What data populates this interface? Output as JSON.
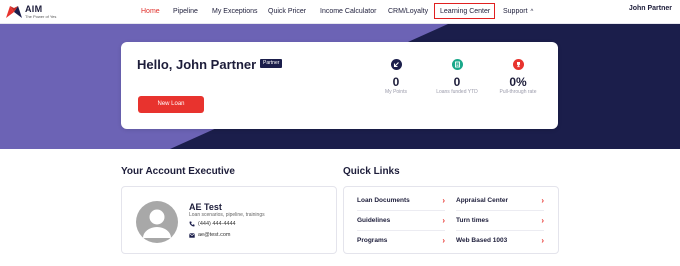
{
  "brand": {
    "name": "AIM",
    "tagline": "The Power of Yes",
    "accent": "#e8332e",
    "navy": "#1b1e4b",
    "purple": "#6c63b5"
  },
  "nav": {
    "items": [
      {
        "label": "Home",
        "active": true
      },
      {
        "label": "Pipeline"
      },
      {
        "label": "My Exceptions"
      },
      {
        "label": "Quick Pricer"
      },
      {
        "label": "Income Calculator"
      },
      {
        "label": "CRM/Loyalty"
      },
      {
        "label": "Learning Center",
        "highlighted": true
      },
      {
        "label": "Support"
      }
    ],
    "support_chevron_icon": "chevron-up-icon",
    "user": "John Partner"
  },
  "hero": {
    "greeting": "Hello, John Partner",
    "badge": "Partner",
    "new_loan_button": "New Loan",
    "stats": [
      {
        "icon": "arrow-down-left-icon",
        "icon_color": "#1b1e4b",
        "value": "0",
        "label": "My Points"
      },
      {
        "icon": "document-icon",
        "icon_color": "#1aa88a",
        "value": "0",
        "label": "Loans funded YTD"
      },
      {
        "icon": "trophy-icon",
        "icon_color": "#e8332e",
        "value": "0%",
        "label": "Pull-through rate"
      }
    ]
  },
  "account_exec": {
    "title": "Your Account Executive",
    "name": "AE Test",
    "description": "Loan scenarios, pipeline, trainings",
    "phone": "(444) 444-4444",
    "email": "ae@test.com"
  },
  "quick_links": {
    "title": "Quick Links",
    "items": [
      {
        "label": "Loan Documents"
      },
      {
        "label": "Appraisal Center"
      },
      {
        "label": "Guidelines"
      },
      {
        "label": "Turn times"
      },
      {
        "label": "Programs"
      },
      {
        "label": "Web Based 1003"
      }
    ],
    "chevron": "›"
  }
}
